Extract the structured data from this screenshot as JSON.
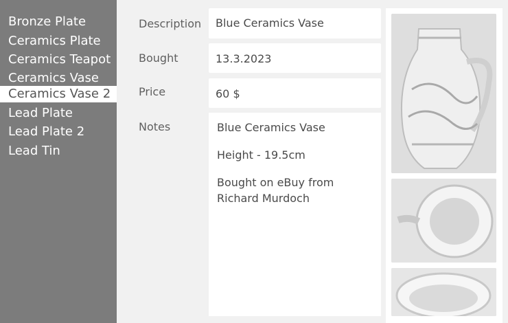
{
  "sidebar": {
    "items": [
      {
        "label": "Bronze Plate"
      },
      {
        "label": "Ceramics Plate"
      },
      {
        "label": "Ceramics Teapot"
      },
      {
        "label": "Ceramics Vase"
      },
      {
        "label": "Ceramics Vase 2",
        "selected": true
      },
      {
        "label": "Lead Plate"
      },
      {
        "label": "Lead Plate 2"
      },
      {
        "label": "Lead Tin"
      }
    ]
  },
  "details": {
    "description_label": "Description",
    "description_value": "Blue Ceramics Vase",
    "bought_label": "Bought",
    "bought_value": "13.3.2023",
    "price_label": "Price",
    "price_value": "60 $",
    "notes_label": "Notes",
    "notes_lines": [
      "Blue Ceramics Vase",
      "Height - 19.5cm",
      "Bought on eBuy from Richard Murdoch"
    ]
  },
  "photos": [
    {
      "alt": "vase-front-photo"
    },
    {
      "alt": "vase-top-photo"
    },
    {
      "alt": "vase-rim-photo"
    }
  ]
}
